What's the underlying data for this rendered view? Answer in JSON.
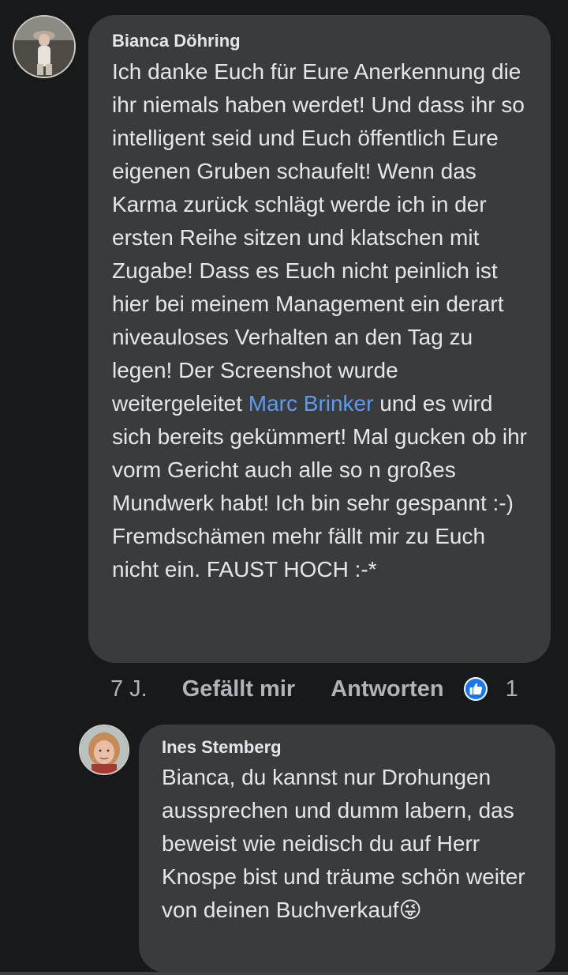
{
  "comment": {
    "author": "Bianca Döhring",
    "text_before_mention": "Ich danke Euch für Eure Anerkennung die ihr niemals haben werdet! Und dass ihr so intelligent seid und Euch öffentlich Eure eigenen Gruben schaufelt! Wenn das Karma zurück schlägt werde ich in der ersten Reihe sitzen und klatschen mit Zugabe! Dass es Euch nicht peinlich ist hier bei meinem Management ein derart niveauloses Verhalten an den Tag zu legen! Der Screenshot wurde weitergeleitet ",
    "mention": "Marc Brinker",
    "text_after_mention": " und es wird sich bereits gekümmert! Mal gucken ob ihr vorm Gericht auch alle so n großes Mundwerk habt! Ich bin sehr gespannt :-) Fremdschämen mehr fällt mir zu Euch nicht ein. FAUST HOCH :-*",
    "time": "7 J.",
    "like_label": "Gefällt mir",
    "reply_label": "Antworten",
    "reaction_icon": "like-icon",
    "reaction_count": "1"
  },
  "reply": {
    "author": "Ines Stemberg",
    "text": "Bianca, du kannst nur Drohungen aussprechen und dumm labern, das beweist wie neidisch du auf Herr Knospe bist und träume schön weiter von deinen Buchverkauf",
    "emoji": "😜"
  },
  "colors": {
    "background": "#18191a",
    "bubble": "#3a3b3c",
    "text": "#e4e6eb",
    "secondary_text": "#b0b3b8",
    "mention": "#5b9bf0",
    "like_blue": "#1877f2"
  }
}
